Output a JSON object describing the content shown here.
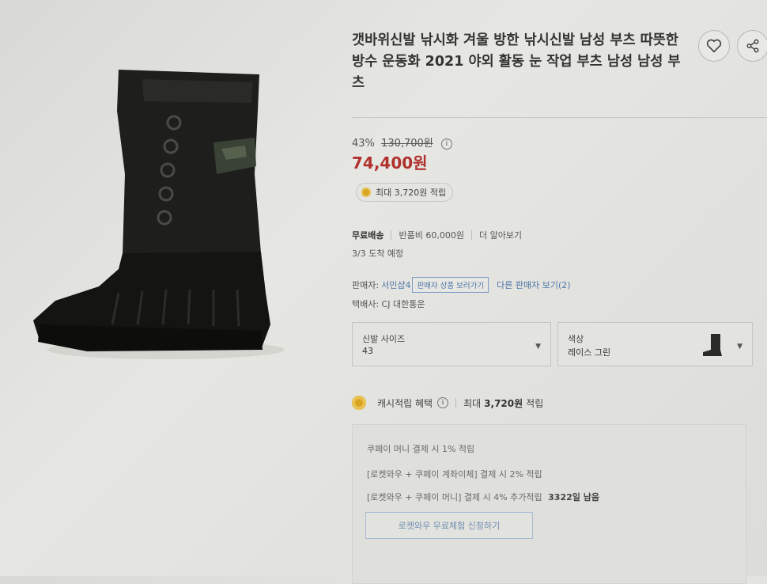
{
  "product": {
    "title": "갯바위신발 낚시화 겨울 방한 낚시신발 남성 부츠 따뜻한 방수 운동화 2021 야외 활동 눈 작업 부츠 남성 남성 부츠",
    "image_icon": "black-winter-boot"
  },
  "actions": {
    "wishlist_icon": "heart-icon",
    "share_icon": "share-icon"
  },
  "pricing": {
    "discount_rate": "43%",
    "original_price": "130,700원",
    "price": "74,400원",
    "cash_badge": "최대 3,720원 적립"
  },
  "shipping": {
    "type": "무료배송",
    "return_fee": "반품비 60,000원",
    "more": "더 알아보기",
    "arrival": "3/3 도착 예정"
  },
  "seller": {
    "label": "판매자:",
    "name": "서민샵4",
    "products_button": "판매자 상품 보러가기",
    "other_sellers": "다른 판매자 보기(2)",
    "courier": "택배사: CJ 대한통운"
  },
  "options": {
    "size": {
      "label": "신발 사이즈",
      "value": "43"
    },
    "color": {
      "label": "색상",
      "value": "레이스 그린"
    }
  },
  "cash_benefit": {
    "title": "캐시적립 혜택",
    "max": "최대",
    "amount": "3,720원",
    "suffix": "적립",
    "lines": [
      "쿠페이 머니 결제 시 1% 적립",
      "[로켓와우 + 쿠페이 계좌이체] 결제 시 2% 적립",
      "[로켓와우 + 쿠페이 머니] 결제 시 4% 추가적립"
    ],
    "days_left": "3322일 남음",
    "trial_button": "로켓와우 무료체험 신청하기"
  },
  "colors": {
    "price_red": "#b0302c",
    "link_blue": "#4f77a8",
    "coin_gold": "#d8a523"
  }
}
